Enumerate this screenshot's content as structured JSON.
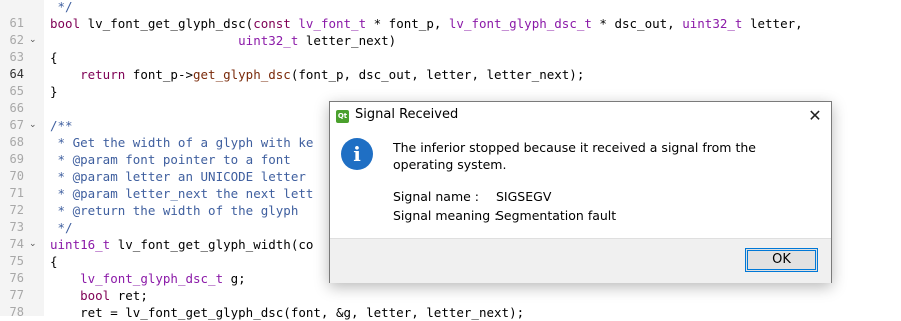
{
  "editor": {
    "lines": [
      {
        "num": "",
        "fold": "",
        "tokens": [
          [
            "cm",
            " */"
          ]
        ]
      },
      {
        "num": "61",
        "fold": "",
        "tokens": [
          [
            "kw",
            "bool"
          ],
          [
            "id",
            " lv_font_get_glyph_dsc("
          ],
          [
            "kw",
            "const"
          ],
          [
            "id",
            " "
          ],
          [
            "type",
            "lv_font_t"
          ],
          [
            "id",
            " * font_p, "
          ],
          [
            "type",
            "lv_font_glyph_dsc_t"
          ],
          [
            "id",
            " * dsc_out, "
          ],
          [
            "type",
            "uint32_t"
          ],
          [
            "id",
            " letter,"
          ]
        ]
      },
      {
        "num": "62",
        "fold": "⌄",
        "tokens": [
          [
            "id",
            "                         "
          ],
          [
            "type",
            "uint32_t"
          ],
          [
            "id",
            " letter_next)"
          ]
        ]
      },
      {
        "num": "63",
        "fold": "",
        "tokens": [
          [
            "id",
            "{"
          ]
        ]
      },
      {
        "num": "64",
        "fold": "",
        "tokens": [
          [
            "id",
            "    "
          ],
          [
            "kw",
            "return"
          ],
          [
            "id",
            " font_p->"
          ],
          [
            "fn",
            "get_glyph_dsc"
          ],
          [
            "id",
            "(font_p, dsc_out, letter, letter_next);"
          ]
        ]
      },
      {
        "num": "65",
        "fold": "",
        "tokens": [
          [
            "id",
            "}"
          ]
        ]
      },
      {
        "num": "66",
        "fold": "",
        "tokens": []
      },
      {
        "num": "67",
        "fold": "⌄",
        "tokens": [
          [
            "cm",
            "/**"
          ]
        ]
      },
      {
        "num": "68",
        "fold": "",
        "tokens": [
          [
            "cm",
            " * Get the width of a glyph with ke"
          ]
        ]
      },
      {
        "num": "69",
        "fold": "",
        "tokens": [
          [
            "cm",
            " * @param font pointer to a font"
          ]
        ]
      },
      {
        "num": "70",
        "fold": "",
        "tokens": [
          [
            "cm",
            " * @param letter an UNICODE letter"
          ]
        ]
      },
      {
        "num": "71",
        "fold": "",
        "tokens": [
          [
            "cm",
            " * @param letter_next the next lett"
          ]
        ]
      },
      {
        "num": "72",
        "fold": "",
        "tokens": [
          [
            "cm",
            " * @return the width of the glyph"
          ]
        ]
      },
      {
        "num": "73",
        "fold": "",
        "tokens": [
          [
            "cm",
            " */"
          ]
        ]
      },
      {
        "num": "74",
        "fold": "⌄",
        "tokens": [
          [
            "type",
            "uint16_t"
          ],
          [
            "id",
            " lv_font_get_glyph_width(co"
          ]
        ]
      },
      {
        "num": "75",
        "fold": "",
        "tokens": [
          [
            "id",
            "{"
          ]
        ]
      },
      {
        "num": "76",
        "fold": "",
        "tokens": [
          [
            "id",
            "    "
          ],
          [
            "type",
            "lv_font_glyph_dsc_t"
          ],
          [
            "id",
            " g;"
          ]
        ]
      },
      {
        "num": "77",
        "fold": "",
        "tokens": [
          [
            "id",
            "    "
          ],
          [
            "kw",
            "bool"
          ],
          [
            "id",
            " ret;"
          ]
        ]
      },
      {
        "num": "78",
        "fold": "",
        "tokens": [
          [
            "id",
            "    ret = lv_font_get_glyph_dsc(font, &g, letter, letter_next);"
          ]
        ]
      }
    ],
    "current_line": "64",
    "colors": {
      "keyword": "#7f0055",
      "type": "#8b1aa8",
      "comment": "#3f5f9f",
      "function": "#7a2a0a",
      "line_number": "#a8a8a8"
    }
  },
  "dialog": {
    "title": "Signal Received",
    "app_icon": "app-icon",
    "close_label": "✕",
    "info_icon_glyph": "i",
    "message": "The inferior stopped because it received a signal from the operating system.",
    "signal_name_label": "Signal name :",
    "signal_name_value": "SIGSEGV",
    "signal_meaning_label": "Signal meaning :",
    "signal_meaning_value": "Segmentation fault",
    "ok_label": "OK",
    "accent_color": "#0078d7"
  }
}
